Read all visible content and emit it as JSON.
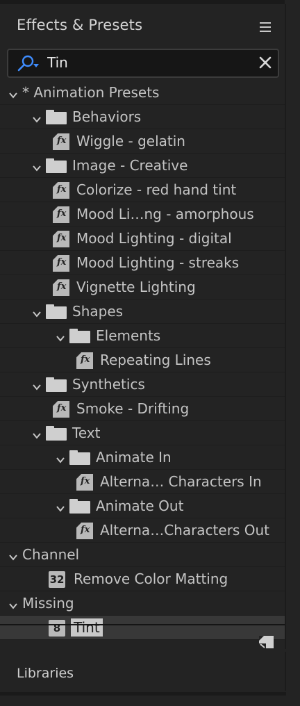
{
  "panel": {
    "title": "Effects & Presets"
  },
  "search": {
    "value": "Tin"
  },
  "tree": [
    {
      "label": "* Animation Presets",
      "type": "category",
      "depth": 0,
      "expanded": true
    },
    {
      "label": "Behaviors",
      "type": "folder",
      "depth": 1,
      "expanded": true
    },
    {
      "label": "Wiggle - gelatin",
      "type": "preset",
      "depth": 2
    },
    {
      "label": "Image - Creative",
      "type": "folder",
      "depth": 1,
      "expanded": true
    },
    {
      "label": "Colorize - red hand tint",
      "type": "preset",
      "depth": 2
    },
    {
      "label": "Mood Li…ng - amorphous",
      "type": "preset",
      "depth": 2
    },
    {
      "label": "Mood Lighting - digital",
      "type": "preset",
      "depth": 2
    },
    {
      "label": "Mood Lighting - streaks",
      "type": "preset",
      "depth": 2
    },
    {
      "label": "Vignette Lighting",
      "type": "preset",
      "depth": 2
    },
    {
      "label": "Shapes",
      "type": "folder",
      "depth": 1,
      "expanded": true
    },
    {
      "label": "Elements",
      "type": "folder",
      "depth": 2,
      "expanded": true
    },
    {
      "label": "Repeating Lines",
      "type": "preset",
      "depth": 3
    },
    {
      "label": "Synthetics",
      "type": "folder",
      "depth": 1,
      "expanded": true
    },
    {
      "label": "Smoke - Drifting",
      "type": "preset",
      "depth": 2
    },
    {
      "label": "Text",
      "type": "folder",
      "depth": 1,
      "expanded": true
    },
    {
      "label": "Animate In",
      "type": "folder",
      "depth": 2,
      "expanded": true
    },
    {
      "label": "Alterna… Characters In",
      "type": "preset",
      "depth": 3
    },
    {
      "label": "Animate Out",
      "type": "folder",
      "depth": 2,
      "expanded": true
    },
    {
      "label": "Alterna…Characters Out",
      "type": "preset",
      "depth": 3
    },
    {
      "label": "Channel",
      "type": "category",
      "depth": 0,
      "expanded": true
    },
    {
      "label": "Remove Color Matting",
      "type": "effect",
      "badge": "32",
      "depth": 1
    },
    {
      "label": "Missing",
      "type": "category",
      "depth": 0,
      "expanded": true
    },
    {
      "label": "Tint",
      "type": "effect",
      "badge": "8",
      "depth": 1,
      "selected": true
    }
  ],
  "libraries": {
    "title": "Libraries"
  },
  "colors": {
    "background": "#232323",
    "text": "#c4c4c4",
    "accent_icon": "#3f8dff",
    "selection": "#383838"
  }
}
